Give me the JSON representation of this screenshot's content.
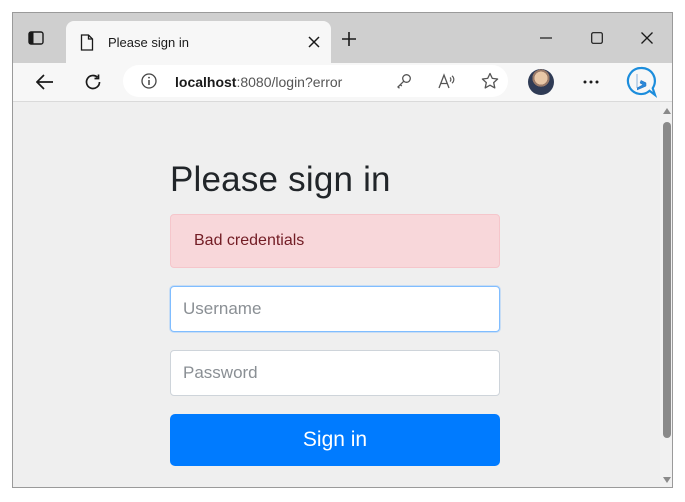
{
  "browser": {
    "tab": {
      "title": "Please sign in"
    },
    "address": {
      "host": "localhost",
      "rest": ":8080/login?error"
    }
  },
  "page": {
    "heading": "Please sign in",
    "alert": "Bad credentials",
    "username_placeholder": "Username",
    "password_placeholder": "Password",
    "submit_label": "Sign in"
  },
  "colors": {
    "primary": "#007bff",
    "alert_bg": "#f8d7da",
    "alert_text": "#721c24"
  },
  "icons": [
    "tab-actions-icon",
    "page-icon",
    "close-icon",
    "plus-icon",
    "minimize-icon",
    "maximize-icon",
    "window-close-icon",
    "back-icon",
    "refresh-icon",
    "info-icon",
    "key-icon",
    "read-aloud-icon",
    "star-icon",
    "more-icon",
    "bing-icon"
  ]
}
